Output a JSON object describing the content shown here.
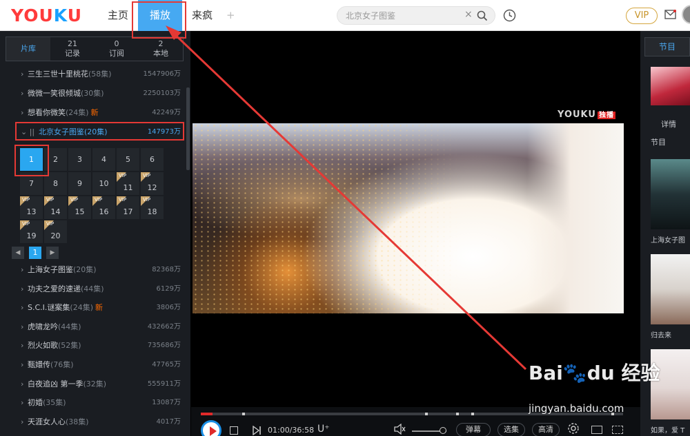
{
  "topbar": {
    "logo_you": "YOU",
    "logo_k": "K",
    "logo_u": "U",
    "tabs": [
      "主页",
      "播放",
      "来疯"
    ],
    "plus": "+",
    "search_placeholder": "北京女子图鉴",
    "clear": "×",
    "vip": "VIP"
  },
  "left_tabs": {
    "library": "片库",
    "records_count": "21",
    "records_label": "记录",
    "subs_count": "0",
    "subs_label": "订阅",
    "local_count": "2",
    "local_label": "本地"
  },
  "series_top": [
    {
      "title": "三生三世十里桃花",
      "count": "(58集)",
      "views": "1547906万",
      "new": ""
    },
    {
      "title": "微微一笑很倾城",
      "count": "(30集)",
      "views": "2250103万",
      "new": ""
    },
    {
      "title": "想看你微笑",
      "count": "(24集)",
      "views": "42249万",
      "new": "新"
    }
  ],
  "series_active": {
    "title": "北京女子图鉴",
    "count": "(20集)",
    "views": "147973万"
  },
  "episodes": [
    "1",
    "2",
    "3",
    "4",
    "5",
    "6",
    "7",
    "8",
    "9",
    "10",
    "11",
    "12",
    "13",
    "14",
    "15",
    "16",
    "17",
    "18",
    "19",
    "20"
  ],
  "vip_badge": "VIP",
  "pager": {
    "prev": "◀",
    "current": "1",
    "next": "▶"
  },
  "series_bottom": [
    {
      "title": "上海女子图鉴",
      "count": "(20集)",
      "views": "82368万",
      "new": ""
    },
    {
      "title": "功夫之爱的速递",
      "count": "(44集)",
      "views": "6129万",
      "new": ""
    },
    {
      "title": "S.C.I.谜案集",
      "count": "(24集)",
      "views": "3806万",
      "new": "新"
    },
    {
      "title": "虎啸龙吟",
      "count": "(44集)",
      "views": "432662万",
      "new": ""
    },
    {
      "title": "烈火如歌",
      "count": "(52集)",
      "views": "735686万",
      "new": ""
    },
    {
      "title": "甄嬛传",
      "count": "(76集)",
      "views": "47765万",
      "new": ""
    },
    {
      "title": "白夜追凶 第一季",
      "count": "(32集)",
      "views": "555911万",
      "new": ""
    },
    {
      "title": "初婚",
      "count": "(35集)",
      "views": "13087万",
      "new": ""
    },
    {
      "title": "天涯女人心",
      "count": "(38集)",
      "views": "4017万",
      "new": ""
    }
  ],
  "player": {
    "watermark": "YOUKU",
    "watermark_tag": "独播",
    "time": "01:00/36:58",
    "progress_fraction": 0.027,
    "danmaku": "弹幕",
    "select_ep": "选集",
    "quality": "高清"
  },
  "right": {
    "tab": "节目",
    "details": "详情",
    "section": "节目",
    "item1": "上海女子图",
    "item2": "归去来",
    "item3": "如果，爱 T"
  },
  "baidu": {
    "main": "Bai",
    "paw": "du",
    "jingyan": "经验",
    "url": "jingyan.baidu.com"
  },
  "colors": {
    "accent": "#46a9f2",
    "annotation": "#e53935",
    "new_badge": "#ff6a00",
    "progress": "#e02a2a"
  }
}
